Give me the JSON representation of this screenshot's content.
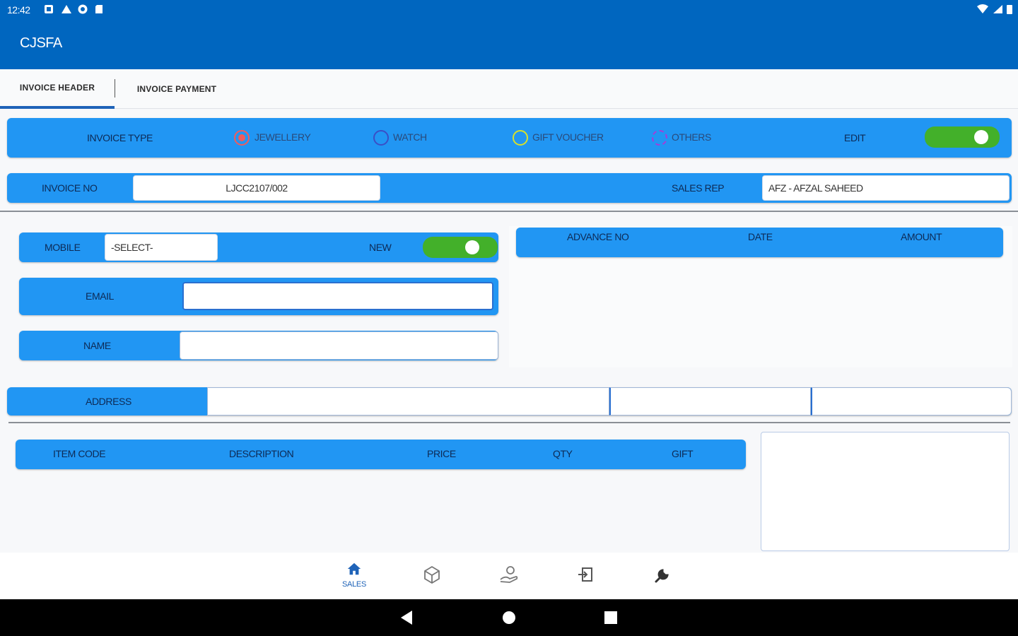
{
  "status_bar": {
    "time": "12:42"
  },
  "app": {
    "title": "CJSFA"
  },
  "tabs": [
    {
      "label": "INVOICE HEADER",
      "active": true
    },
    {
      "label": "INVOICE PAYMENT",
      "active": false
    }
  ],
  "invoice_type": {
    "label": "INVOICE TYPE",
    "options": [
      {
        "label": "JEWELLERY",
        "selected": true,
        "color": "#f25b5b"
      },
      {
        "label": "WATCH",
        "selected": false,
        "color": "#3a4fc6"
      },
      {
        "label": "GIFT VOUCHER",
        "selected": false,
        "color": "#d7e12a"
      },
      {
        "label": "OTHERS",
        "selected": false,
        "color": "#a83ad8"
      }
    ],
    "edit_label": "EDIT",
    "edit_on": true
  },
  "invoice": {
    "invoice_no_label": "INVOICE NO",
    "invoice_no_value": "LJCC2107/002",
    "sales_rep_label": "SALES REP",
    "sales_rep_value": "AFZ - AFZAL SAHEED"
  },
  "customer": {
    "mobile_label": "MOBILE",
    "mobile_value": "-SELECT-",
    "new_label": "NEW",
    "new_on": true,
    "email_label": "EMAIL",
    "email_value": "",
    "name_label": "NAME",
    "name_value": ""
  },
  "advance_table": {
    "headers": [
      "ADVANCE NO",
      "DATE",
      "AMOUNT"
    ]
  },
  "address": {
    "label": "ADDRESS",
    "line1": "",
    "line2": "",
    "line3": ""
  },
  "items_table": {
    "headers": [
      "ITEM CODE",
      "DESCRIPTION",
      "PRICE",
      "QTY",
      "GIFT"
    ]
  },
  "bottom_nav": {
    "sales_caption": "SALES"
  },
  "colors": {
    "primary": "#0066bf",
    "bar": "#2196f3",
    "switch_on": "#43b02a"
  }
}
